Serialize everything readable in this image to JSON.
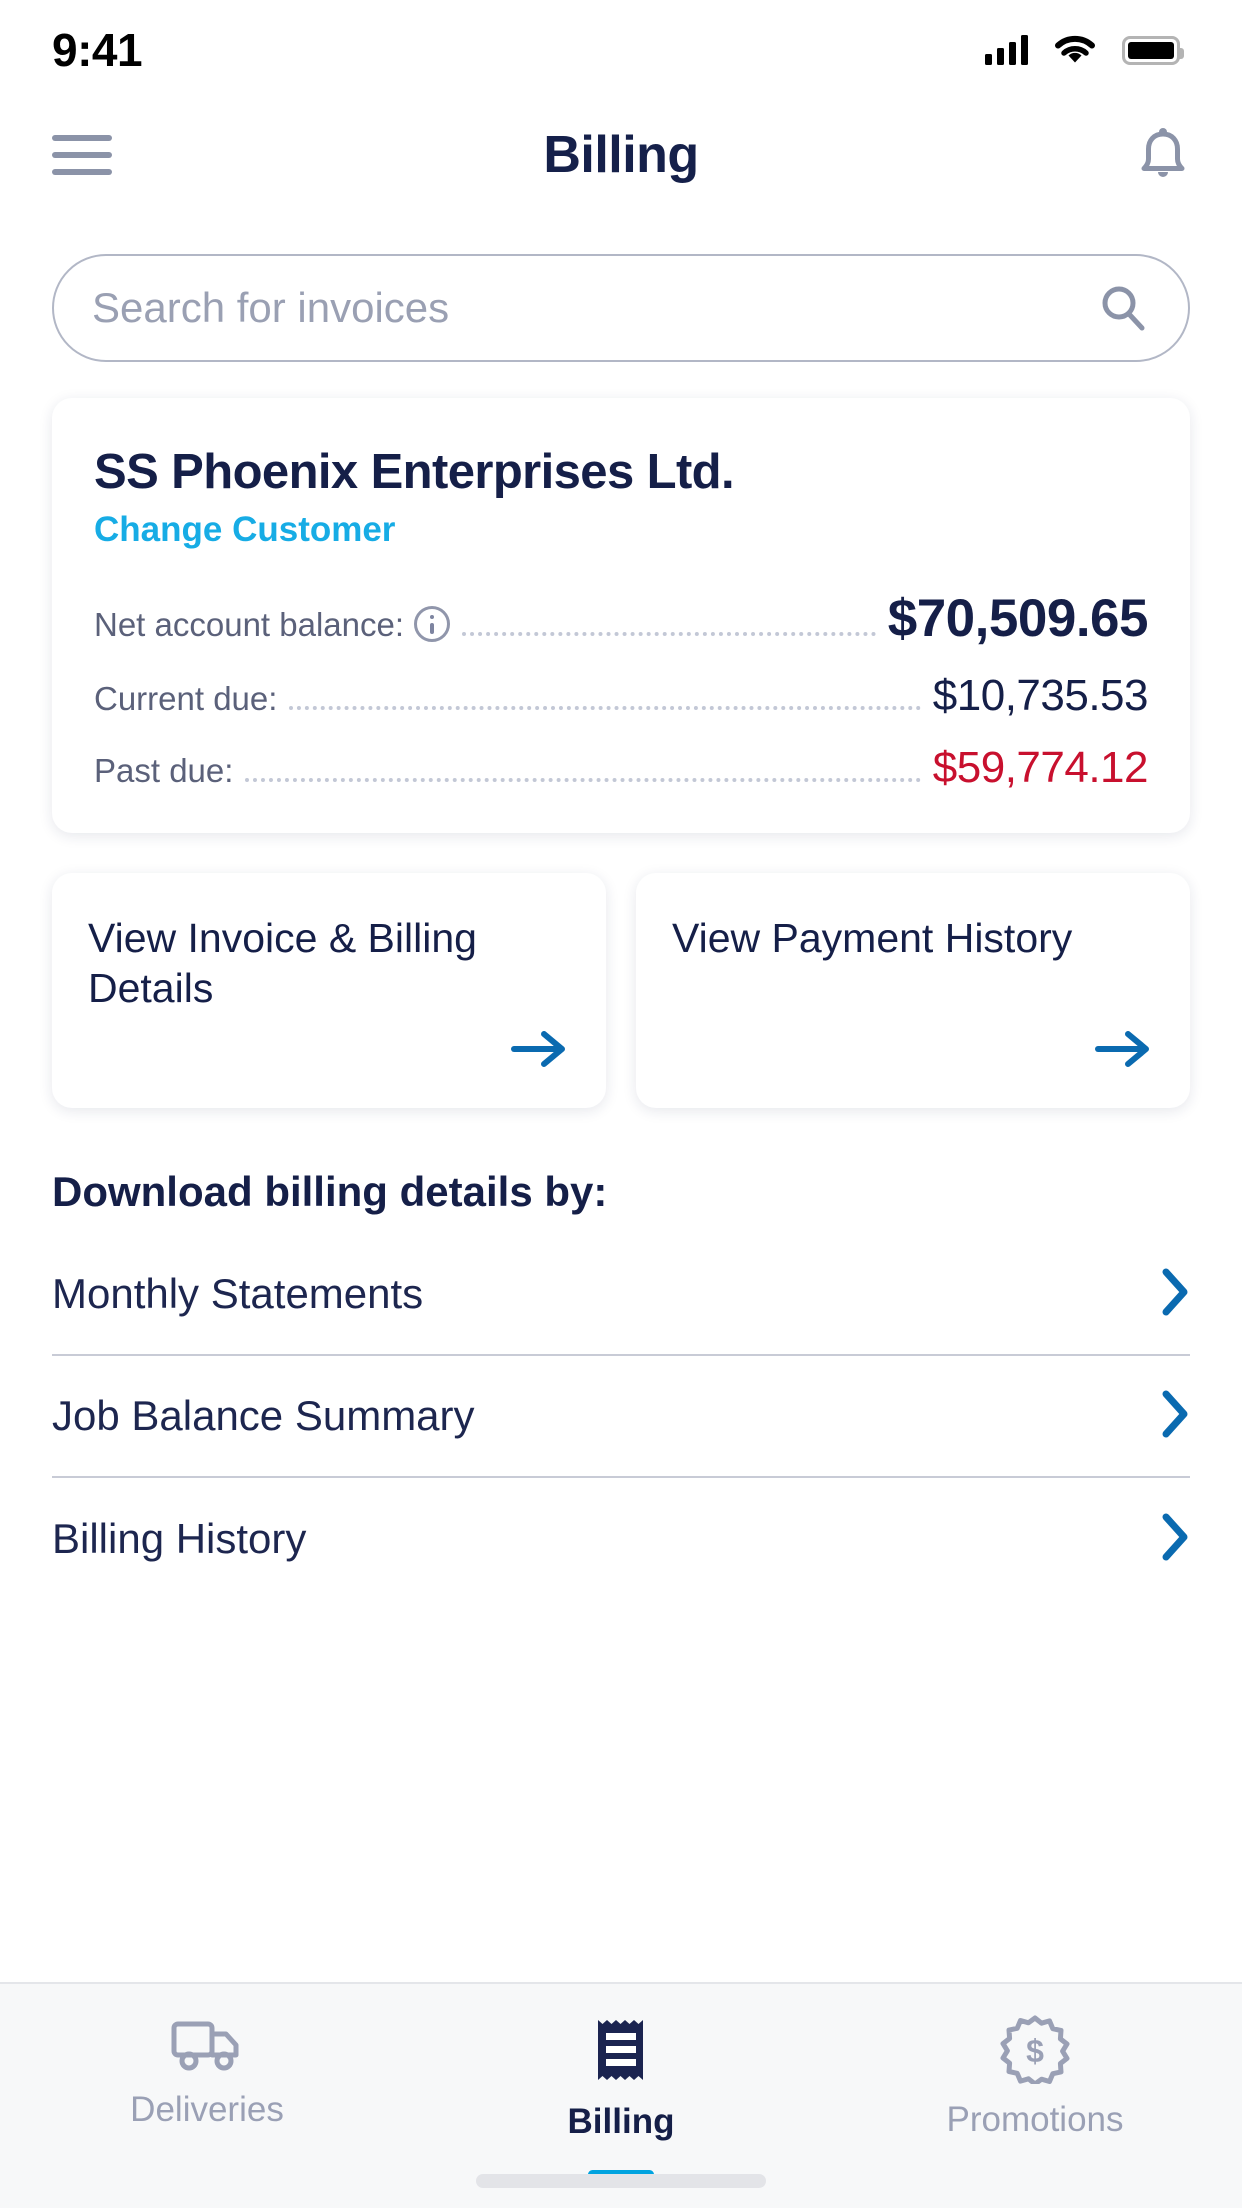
{
  "status_bar": {
    "time": "9:41",
    "signal_icon": "cellular-signal-icon",
    "wifi_icon": "wifi-icon",
    "battery_icon": "battery-full-icon"
  },
  "nav": {
    "menu_icon": "hamburger-menu-icon",
    "title": "Billing",
    "notification_icon": "bell-icon"
  },
  "search": {
    "placeholder": "Search for invoices",
    "value": "",
    "icon": "search-icon"
  },
  "customer_card": {
    "name": "SS Phoenix Enterprises Ltd.",
    "change_link": "Change Customer",
    "balances": [
      {
        "label": "Net account balance:",
        "value": "$70,509.65",
        "has_info_icon": true,
        "emphasis": "big",
        "color": "#151f48"
      },
      {
        "label": "Current due:",
        "value": "$10,735.53",
        "has_info_icon": false,
        "emphasis": "normal",
        "color": "#151f48"
      },
      {
        "label": "Past due:",
        "value": "$59,774.12",
        "has_info_icon": false,
        "emphasis": "danger",
        "color": "#c8102e"
      }
    ]
  },
  "tiles": [
    {
      "title": "View Invoice & Billing Details",
      "arrow_icon": "arrow-right-icon"
    },
    {
      "title": "View Payment History",
      "arrow_icon": "arrow-right-icon"
    }
  ],
  "download_section": {
    "heading": "Download billing details by:",
    "items": [
      {
        "label": "Monthly Statements",
        "chevron_icon": "chevron-right-icon"
      },
      {
        "label": "Job Balance Summary",
        "chevron_icon": "chevron-right-icon"
      },
      {
        "label": "Billing History",
        "chevron_icon": "chevron-right-icon"
      }
    ]
  },
  "tab_bar": {
    "tabs": [
      {
        "label": "Deliveries",
        "icon": "truck-icon",
        "active": false
      },
      {
        "label": "Billing",
        "icon": "receipt-icon",
        "active": true
      },
      {
        "label": "Promotions",
        "icon": "dollar-badge-icon",
        "active": false
      }
    ]
  },
  "colors": {
    "navy": "#151f48",
    "accent_cyan": "#17ace5",
    "link_blue": "#0a6ab0",
    "danger_red": "#c8102e",
    "muted_gray": "#9aa0b5"
  }
}
